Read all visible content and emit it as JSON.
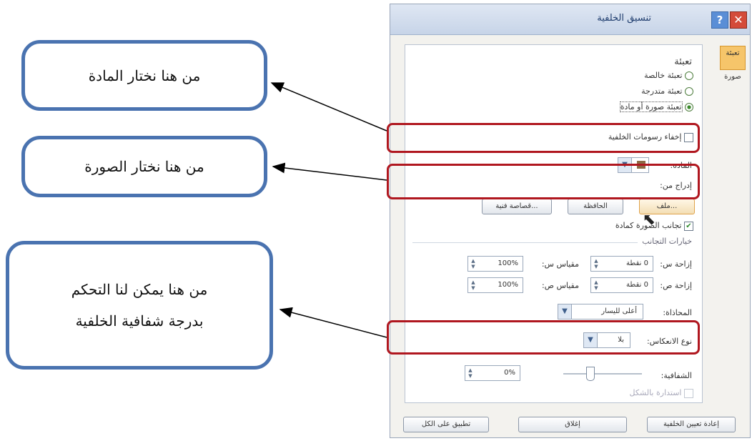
{
  "callouts": {
    "material": "من هنا نختار المادة",
    "picture": "من هنا نختار الصورة",
    "transparency_line1": "من هنا يمكن لنا التحكم",
    "transparency_line2": "بدرجة شفافية الخلفية"
  },
  "dialog": {
    "title": "تنسيق الخلفية",
    "help_icon": "?",
    "close_icon": "✕",
    "tabs": [
      "تعبئة",
      "صورة"
    ],
    "section_fill": "تعبئة",
    "fill_options": [
      "تعبئة خالصة",
      "تعبئة متدرجة",
      "تعبئة صورة أو مادة"
    ],
    "hide_graphics": "إخفاء رسومات الخلفية",
    "texture_label": "المادة:",
    "insert_from": "إدراج من:",
    "btn_file": "ملف...",
    "btn_clipboard": "الحافظة",
    "btn_clipart": "قصاصة فنية...",
    "tile_picture": "تجانب الصورة كمادة",
    "tiling_options": "خيارات التجانب",
    "offset_x_label": "إزاحة س:",
    "offset_x_value": "0 نقطة",
    "offset_y_label": "إزاحة ص:",
    "offset_y_value": "0 نقطة",
    "scale_x_label": "مقياس س:",
    "scale_x_value": "100%",
    "scale_y_label": "مقياس ص:",
    "scale_y_value": "100%",
    "alignment_label": "المحاذاة:",
    "alignment_value": "أعلى لليسار",
    "mirror_label": "نوع الانعكاس:",
    "mirror_value": "بلا",
    "transparency_label": "الشفافية:",
    "transparency_value": "0%",
    "rotate_with_shape": "استدارة بالشكل",
    "btn_reset": "إعادة تعيين الخلفية",
    "btn_close": "إغلاق",
    "btn_apply_all": "تطبيق على الكل"
  }
}
